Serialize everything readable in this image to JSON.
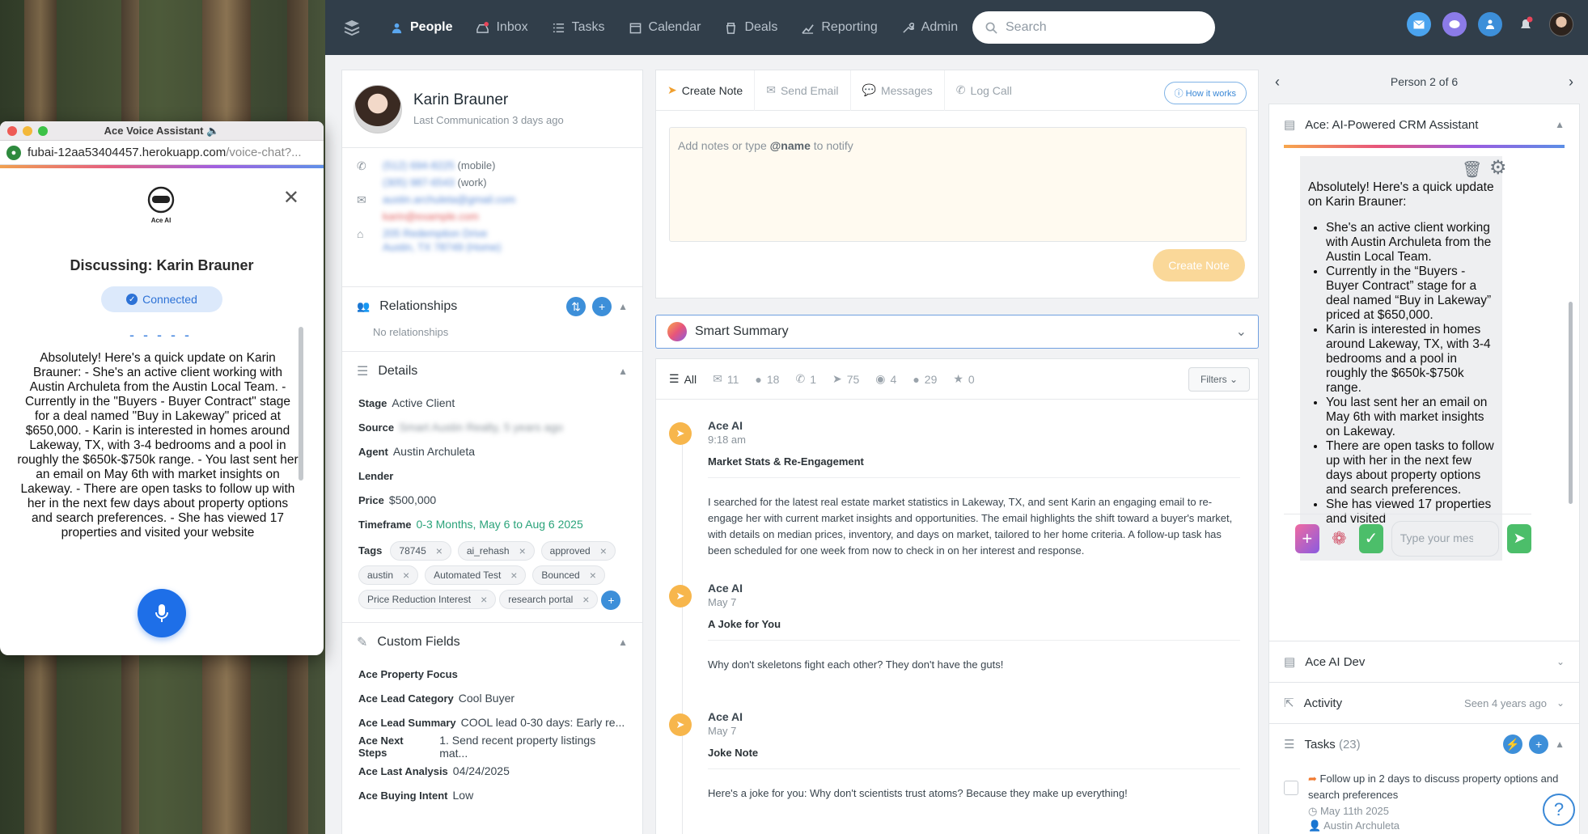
{
  "nav": {
    "items": [
      {
        "label": "People",
        "icon": "person-icon",
        "active": true
      },
      {
        "label": "Inbox",
        "icon": "inbox-icon",
        "active": false
      },
      {
        "label": "Tasks",
        "icon": "tasks-icon",
        "active": false
      },
      {
        "label": "Calendar",
        "icon": "calendar-icon",
        "active": false
      },
      {
        "label": "Deals",
        "icon": "deals-icon",
        "active": false
      },
      {
        "label": "Reporting",
        "icon": "chart-icon",
        "active": false
      },
      {
        "label": "Admin",
        "icon": "wrench-icon",
        "active": false
      }
    ],
    "search_placeholder": "Search"
  },
  "person": {
    "name": "Karin Brauner",
    "last_comm": "Last Communication 3 days ago",
    "phone1": "(512) 694-8225",
    "phone1_type": "(mobile)",
    "phone2": "(305) 987-6543",
    "phone2_type": "(work)",
    "email1": "austin.archuleta@gmail.com",
    "email2": "karin@example.com",
    "address1": "205 Redemption Drive",
    "address2": "Austin, TX 78749 (Home)"
  },
  "relationships": {
    "title": "Relationships",
    "empty": "No relationships"
  },
  "details": {
    "title": "Details",
    "stage_label": "Stage",
    "stage": "Active Client",
    "source_label": "Source",
    "source": "Smart Austin Realty, 5 years ago",
    "agent_label": "Agent",
    "agent": "Austin Archuleta",
    "lender_label": "Lender",
    "price_label": "Price",
    "price": "$500,000",
    "timeframe_label": "Timeframe",
    "timeframe": "0-3 Months, May 6 to Aug 6 2025",
    "tags_label": "Tags",
    "tags": [
      "78745",
      "ai_rehash",
      "approved",
      "austin",
      "Automated Test",
      "Bounced",
      "Price Reduction Interest",
      "research portal"
    ]
  },
  "custom": {
    "title": "Custom Fields",
    "f1": "Ace Property Focus",
    "f2": "Ace Lead Category",
    "v2": "Cool Buyer",
    "f3": "Ace Lead Summary",
    "v3": "COOL lead 0-30 days: Early re...",
    "f4": "Ace Next Steps",
    "v4": "1. Send recent property listings mat...",
    "f5": "Ace Last Analysis",
    "v5": "04/24/2025",
    "f6": "Ace Buying Intent",
    "v6": "Low"
  },
  "note": {
    "tabs": [
      "Create Note",
      "Send Email",
      "Messages",
      "Log Call"
    ],
    "how": "How it works",
    "placeholder_a": "Add notes or type ",
    "placeholder_b": "@name",
    "placeholder_c": " to notify",
    "create": "Create Note"
  },
  "smart_summary": "Smart Summary",
  "feed": {
    "all": "All",
    "counts": [
      "11",
      "18",
      "1",
      "75",
      "4",
      "29",
      "0"
    ],
    "filters": "Filters",
    "entries": [
      {
        "name": "Ace AI",
        "time": "9:18 am",
        "title": "Market Stats & Re-Engagement",
        "body": "I searched for the latest real estate market statistics in Lakeway, TX, and sent Karin an engaging email to re-engage her with current market insights and opportunities. The email highlights the shift toward a buyer's market, with details on median prices, inventory, and days on market, tailored to her home criteria. A follow-up task has been scheduled for one week from now to check in on her interest and response."
      },
      {
        "name": "Ace AI",
        "time": "May 7",
        "title": "A Joke for You",
        "body": "Why don't skeletons fight each other? They don't have the guts!"
      },
      {
        "name": "Ace AI",
        "time": "May 7",
        "title": "Joke Note",
        "body": "Here's a joke for you: Why don't scientists trust atoms? Because they make up everything!"
      }
    ]
  },
  "right": {
    "pager": "Person 2 of 6",
    "ace_title": "Ace: AI-Powered CRM Assistant",
    "ai_intro": "Absolutely! Here's a quick update on Karin Brauner:",
    "ai_bullets": [
      "She's an active client working with Austin Archuleta from the Austin Local Team.",
      "Currently in the “Buyers - Buyer Contract” stage for a deal named “Buy in Lakeway” priced at $650,000.",
      "Karin is interested in homes around Lakeway, TX, with 3-4 bedrooms and a pool in roughly the $650k-$750k range.",
      "You last sent her an email on May 6th with market insights on Lakeway.",
      "There are open tasks to follow up with her in the next few days about property options and search preferences.",
      "She has viewed 17 properties and visited"
    ],
    "type_placeholder": "Type your message",
    "dev_title": "Ace AI Dev",
    "activity_title": "Activity",
    "activity_meta": "Seen 4 years ago",
    "tasks_title": "Tasks",
    "tasks_count": "(23)",
    "task_text": "Follow up in 2 days to discuss property options and search preferences",
    "task_date": "May 11th 2025",
    "task_agent": "Austin Archuleta"
  },
  "popup": {
    "title": "Ace Voice Assistant 🔈",
    "url_main": "fubai-12aa53404457.herokuapp.com",
    "url_path": "/voice-chat?...",
    "logo_text": "Ace AI",
    "discussing": "Discussing: Karin Brauner",
    "status": "Connected",
    "dashes": "- - - - -",
    "transcript": "Absolutely! Here's a quick update on Karin Brauner: - She's an active client working with Austin Archuleta from the Austin Local Team. - Currently in the \"Buyers - Buyer Contract\" stage for a deal named \"Buy in Lakeway\" priced at $650,000. - Karin is interested in homes around Lakeway, TX, with 3-4 bedrooms and a pool in roughly the $650k-$750k range. - You last sent her an email on May 6th with market insights on Lakeway. - There are open tasks to follow up with her in the next few days about property options and search preferences. - She has viewed 17 properties and visited your website"
  },
  "colors": {
    "topbar": "#313e4a",
    "accent": "#3d8fd9",
    "ace_bullet": "#f7b64c",
    "mic": "#1e6fe8"
  }
}
